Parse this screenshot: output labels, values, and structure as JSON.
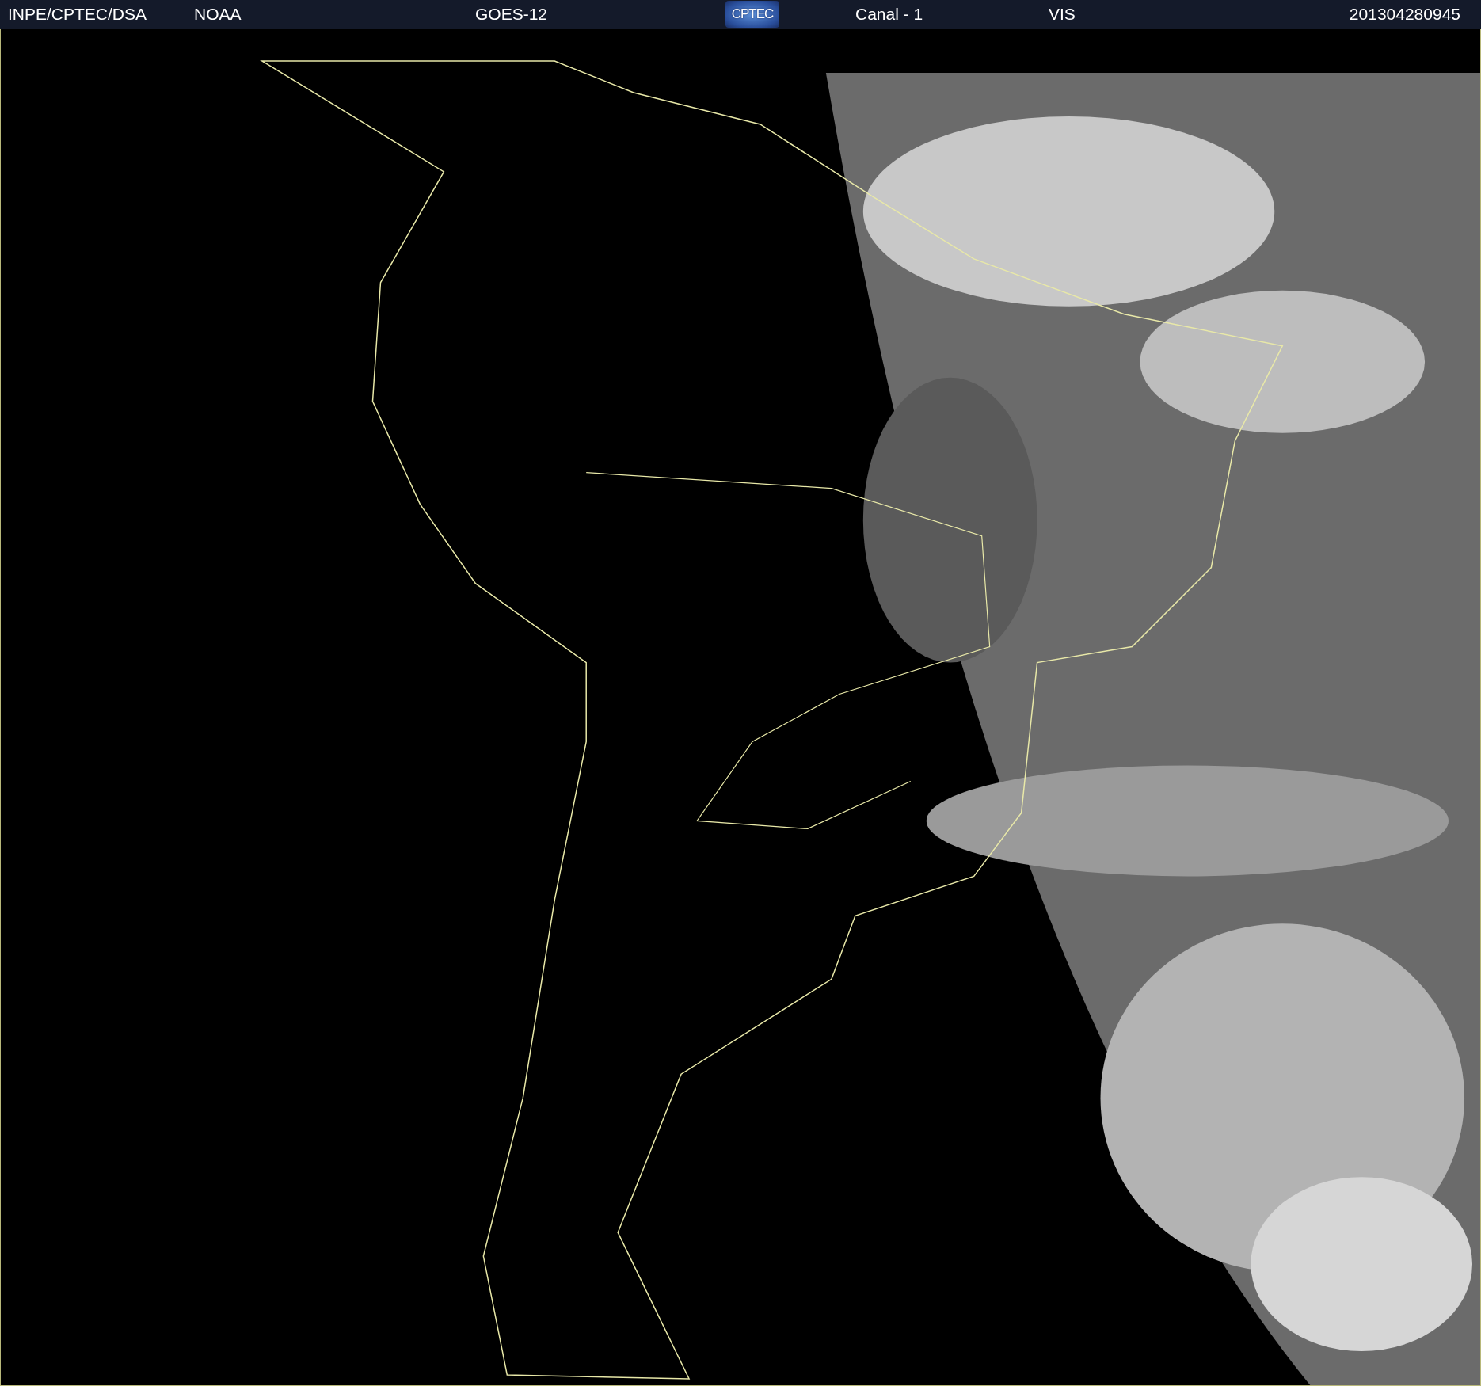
{
  "header": {
    "source": "INPE/CPTEC/DSA",
    "agency": "NOAA",
    "satellite": "GOES-12",
    "logo": "CPTEC",
    "channel": "Canal - 1",
    "band": "VIS",
    "timestamp": "201304280945"
  }
}
